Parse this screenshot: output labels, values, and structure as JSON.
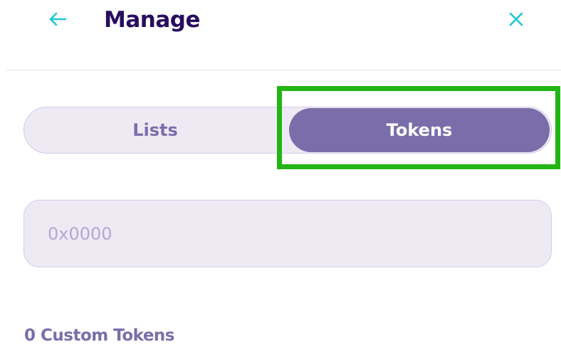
{
  "header": {
    "title": "Manage",
    "back_icon": "arrow-left-icon",
    "close_icon": "close-icon"
  },
  "toggle": {
    "options": [
      {
        "label": "Lists",
        "active": false
      },
      {
        "label": "Tokens",
        "active": true
      }
    ]
  },
  "search": {
    "placeholder": "0x0000",
    "value": ""
  },
  "custom_tokens": {
    "label": "0 Custom Tokens"
  },
  "colors": {
    "title_text": "#280d5f",
    "accent_teal": "#1fc7d4",
    "toggle_active_bg": "#7a6eaa",
    "toggle_bg": "#eeeaf4",
    "highlight_border": "#22b513"
  }
}
